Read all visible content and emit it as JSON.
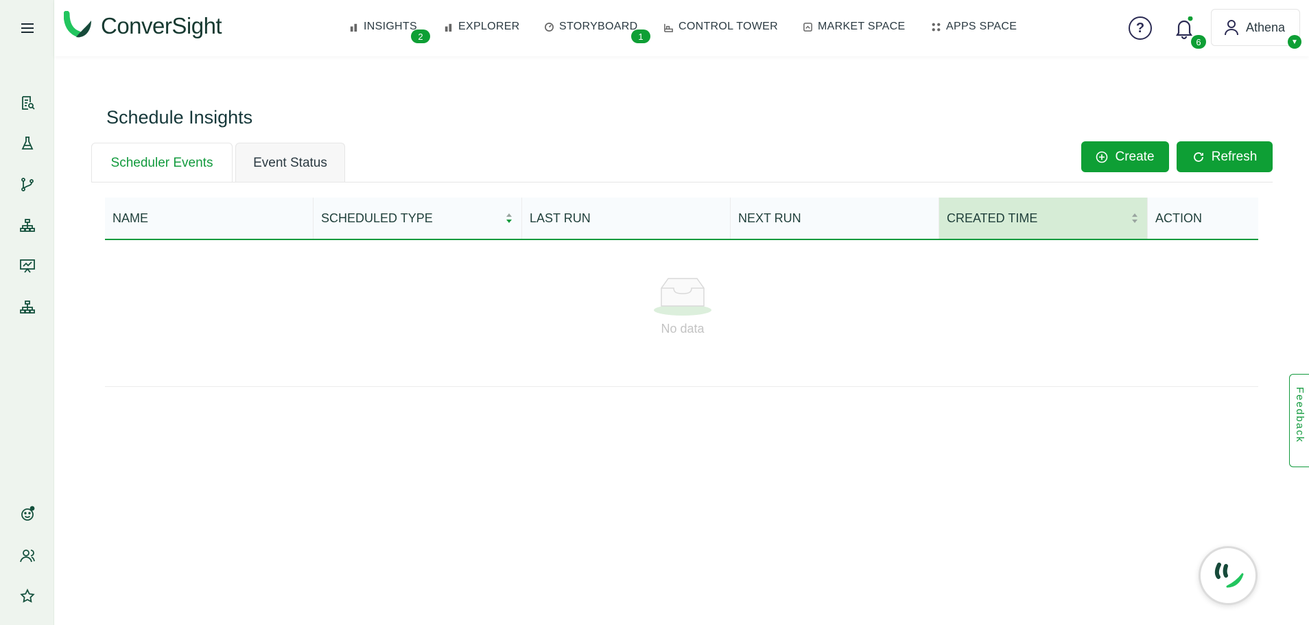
{
  "app": {
    "brand": "ConverSight"
  },
  "nav": {
    "items": [
      {
        "label": "INSIGHTS",
        "badge": "2"
      },
      {
        "label": "EXPLORER"
      },
      {
        "label": "STORYBOARD",
        "badge": "1"
      },
      {
        "label": "CONTROL TOWER"
      },
      {
        "label": "MARKET SPACE"
      },
      {
        "label": "APPS SPACE"
      }
    ]
  },
  "header": {
    "help_label": "?",
    "notifications": "6",
    "user_name": "Athena"
  },
  "page": {
    "title": "Schedule Insights",
    "tabs": [
      "Scheduler Events",
      "Event Status"
    ],
    "create_label": "Create",
    "refresh_label": "Refresh"
  },
  "table": {
    "columns": [
      "NAME",
      "SCHEDULED TYPE",
      "LAST RUN",
      "NEXT RUN",
      "CREATED TIME",
      "ACTION"
    ],
    "empty_text": "No data"
  },
  "feedback_label": "Feedback",
  "colors": {
    "accent": "#0e9f35",
    "sidebar": "#eef4ee",
    "header_highlight": "#d6ecd6"
  }
}
